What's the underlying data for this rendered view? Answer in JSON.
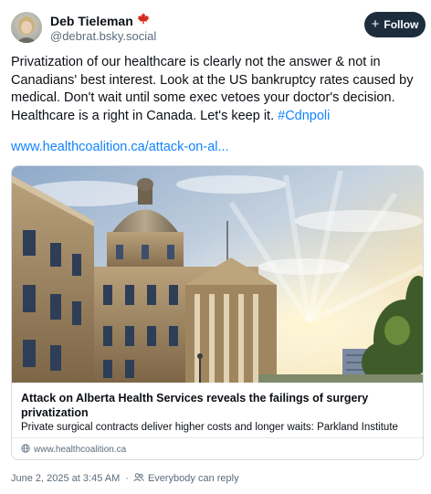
{
  "author": {
    "name": "Deb Tieleman",
    "handle": "@debrat.bsky.social",
    "badge_icon": "maple-leaf-icon",
    "badge_color": "#d52b1e"
  },
  "follow_button": {
    "label": "Follow",
    "icon": "plus-icon",
    "color": "#1e2d3d"
  },
  "post": {
    "text": "Privatization of our healthcare is clearly not the answer & not in Canadians' best interest. Look at the US bankruptcy rates caused by medical.  Don't wait until some exec vetoes your doctor's decision. Healthcare is a right in Canada. Let's keep it. ",
    "hashtag": "#Cdnpoli",
    "link": "www.healthcoalition.ca/attack-on-al...",
    "link_color": "#1083fe"
  },
  "link_card": {
    "title": "Attack on Alberta Health Services reveals the failings of surgery privatization",
    "description": "Private surgical contracts deliver higher costs and longer waits: Parkland Institute",
    "domain": "www.healthcoalition.ca",
    "domain_icon": "globe-icon"
  },
  "footer": {
    "timestamp": "June 2, 2025 at 3:45 AM",
    "separator": "·",
    "reply_setting": "Everybody can reply",
    "reply_icon": "people-icon"
  }
}
